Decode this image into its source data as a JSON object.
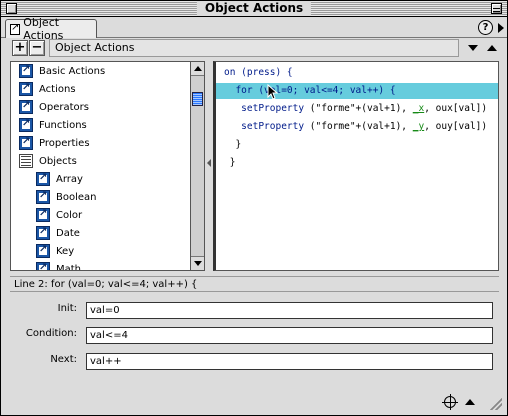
{
  "window": {
    "title": "Object Actions"
  },
  "tab": {
    "label": "Object Actions"
  },
  "toolbar": {
    "add_label": "+",
    "remove_label": "−",
    "path": "Object Actions"
  },
  "help_label": "?",
  "left_list": {
    "items": [
      {
        "label": "Basic Actions",
        "level": 0,
        "icon": "book-icon"
      },
      {
        "label": "Actions",
        "level": 0,
        "icon": "book-icon"
      },
      {
        "label": "Operators",
        "level": 0,
        "icon": "book-icon"
      },
      {
        "label": "Functions",
        "level": 0,
        "icon": "book-icon"
      },
      {
        "label": "Properties",
        "level": 0,
        "icon": "book-icon"
      },
      {
        "label": "Objects",
        "level": 0,
        "icon": "open-book-icon"
      },
      {
        "label": "Array",
        "level": 1,
        "icon": "book-icon"
      },
      {
        "label": "Boolean",
        "level": 1,
        "icon": "book-icon"
      },
      {
        "label": "Color",
        "level": 1,
        "icon": "book-icon"
      },
      {
        "label": "Date",
        "level": 1,
        "icon": "book-icon"
      },
      {
        "label": "Key",
        "level": 1,
        "icon": "book-icon"
      },
      {
        "label": "Math",
        "level": 1,
        "icon": "book-icon"
      }
    ]
  },
  "code": {
    "lines": [
      {
        "parts": [
          [
            "kw",
            "on (press) {"
          ]
        ]
      },
      {
        "parts": [
          [
            "kw",
            "  for (val=0; val<=4; val++) {"
          ]
        ]
      },
      {
        "parts": [
          [
            "fn",
            "   setProperty "
          ],
          [
            "txt",
            "(\"forme\"+(val+1), "
          ],
          [
            "prop",
            "_x"
          ],
          [
            "txt",
            ", oux[val])"
          ]
        ]
      },
      {
        "parts": [
          [
            "fn",
            "   setProperty "
          ],
          [
            "txt",
            "(\"forme\"+(val+1), "
          ],
          [
            "prop",
            "_y"
          ],
          [
            "txt",
            ", ouy[val])"
          ]
        ]
      },
      {
        "parts": [
          [
            "txt",
            "  }"
          ]
        ]
      },
      {
        "parts": [
          [
            "txt",
            " }"
          ]
        ]
      }
    ],
    "highlighted_line": 2
  },
  "status": {
    "text": "Line 2: for (val=0; val<=4; val++) {"
  },
  "form": {
    "init_label": "Init:",
    "init_value": "val=0",
    "condition_label": "Condition:",
    "condition_value": "val<=4",
    "next_label": "Next:",
    "next_value": "val++"
  },
  "colors": {
    "highlight": "#66ccdd",
    "keyword": "#001b8a",
    "property": "#178a17",
    "window_bg": "#dcdcdc"
  }
}
